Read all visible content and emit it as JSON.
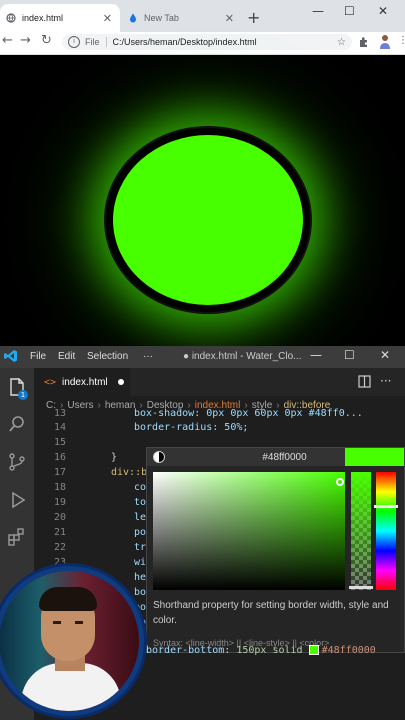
{
  "browser": {
    "tabs": [
      {
        "label": "index.html",
        "active": true
      },
      {
        "label": "New Tab",
        "active": false
      }
    ],
    "new_tab": "+",
    "window_controls": [
      "—",
      "☐",
      "✕"
    ],
    "nav": {
      "back": "←",
      "forward": "→",
      "reload": "↻"
    },
    "address": {
      "scheme": "File",
      "url": "C:/Users/heman/Desktop/index.html"
    }
  },
  "page": {
    "circle_color": "#48ff00",
    "background": "#000000"
  },
  "vscode": {
    "menu": [
      "File",
      "Edit",
      "Selection",
      "···"
    ],
    "title": "● index.html - Water_Clo...",
    "window_controls": [
      "—",
      "☐",
      "✕"
    ],
    "tab": {
      "label": "index.html",
      "modified": true
    },
    "badge": "1",
    "breadcrumbs": [
      "C:",
      "Users",
      "heman",
      "Desktop",
      "index.html",
      "style",
      "div::before"
    ],
    "lines": [
      {
        "n": "13",
        "text": "box-shadow: 0px 0px 60px 0px #48ff0..."
      },
      {
        "n": "14",
        "text": "border-radius: 50%;"
      },
      {
        "n": "15",
        "text": ""
      },
      {
        "n": "16",
        "text": "}"
      },
      {
        "n": "17",
        "text": "div::b"
      },
      {
        "n": "18",
        "text": "co"
      },
      {
        "n": "19",
        "text": "to"
      },
      {
        "n": "20",
        "text": "le"
      },
      {
        "n": "21",
        "text": "po"
      },
      {
        "n": "22",
        "text": "tr"
      },
      {
        "n": "23",
        "text": "wi"
      },
      {
        "n": "24",
        "text": "he"
      },
      {
        "n": "25",
        "text": "bo"
      },
      {
        "n": "26",
        "text": "bo"
      },
      {
        "n": "27",
        "text": "bo"
      },
      {
        "n": "28",
        "text": "bo"
      }
    ],
    "bottom_line": {
      "prop": "border-bottom:",
      "value": "150px solid",
      "color": "#48ff0000"
    }
  },
  "picker": {
    "hex": "#48ff0000",
    "color": "#48ff00",
    "hover_text": "Shorthand property for setting border width, style and color.",
    "syntax": "Syntax: <line-width> || <line-style> || <color>"
  },
  "icons": [
    "globe-icon",
    "water-drop-icon",
    "info-icon",
    "star-icon",
    "extensions-icon",
    "profile-icon",
    "vscode-logo-icon",
    "explorer-icon",
    "search-icon",
    "source-control-icon",
    "run-debug-icon",
    "extensions-icon",
    "split-editor-icon",
    "more-icon"
  ]
}
